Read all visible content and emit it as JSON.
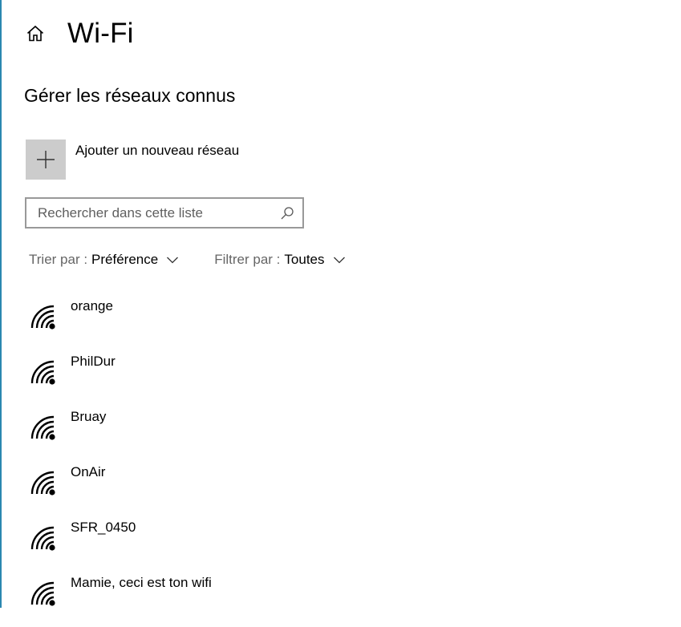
{
  "header": {
    "title": "Wi-Fi",
    "home_icon": "home-icon"
  },
  "section": {
    "title": "Gérer les réseaux connus"
  },
  "add_network": {
    "label": "Ajouter un nouveau réseau",
    "icon": "plus-icon"
  },
  "search": {
    "placeholder": "Rechercher dans cette liste",
    "value": "",
    "icon": "search-icon"
  },
  "sort": {
    "prefix": "Trier par :",
    "value": "Préférence"
  },
  "filter": {
    "prefix": "Filtrer par :",
    "value": "Toutes"
  },
  "networks": [
    {
      "name": "orange",
      "icon": "wifi-icon"
    },
    {
      "name": "PhilDur",
      "icon": "wifi-icon"
    },
    {
      "name": "Bruay",
      "icon": "wifi-icon"
    },
    {
      "name": "OnAir",
      "icon": "wifi-icon"
    },
    {
      "name": "SFR_0450",
      "icon": "wifi-icon"
    },
    {
      "name": "Mamie, ceci est ton wifi",
      "icon": "wifi-icon"
    }
  ],
  "colors": {
    "accent_edge": "#2b87b0",
    "add_tile_bg": "#cccccc",
    "search_border": "#999999",
    "secondary_text": "#666666"
  }
}
